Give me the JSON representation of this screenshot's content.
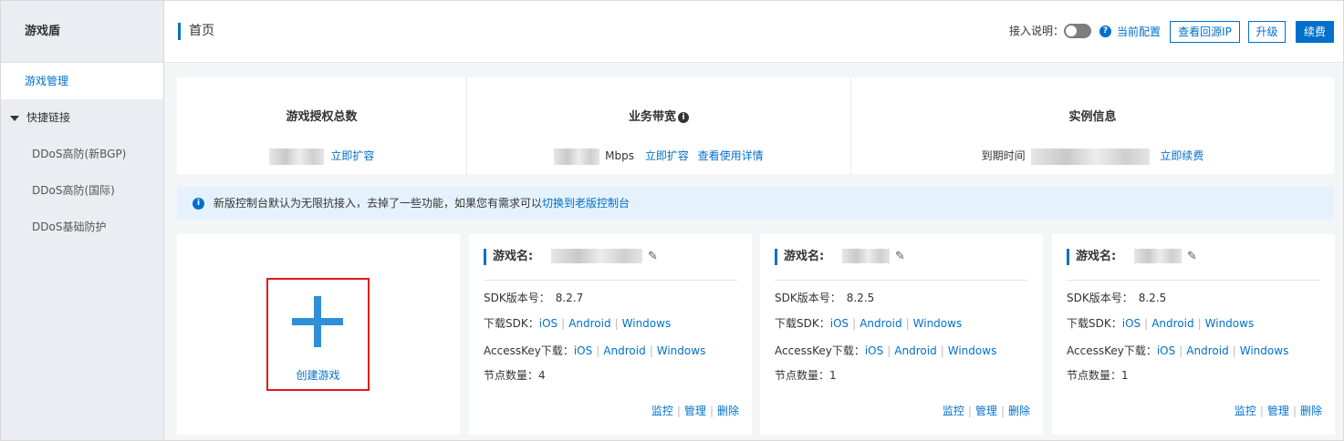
{
  "sidebar": {
    "title": "游戏盾",
    "active_item": "游戏管理",
    "group_label": "快捷链接",
    "links": [
      "DDoS高防(新BGP)",
      "DDoS高防(国际)",
      "DDoS基础防护"
    ]
  },
  "header": {
    "page_title": "首页",
    "access_label": "接入说明：",
    "current_config": "当前配置",
    "view_origin_ip": "查看回源IP",
    "upgrade": "升级",
    "renew": "续费"
  },
  "stats": {
    "license": {
      "title": "游戏授权总数",
      "action": "立即扩容"
    },
    "bandwidth": {
      "title": "业务带宽",
      "unit": "Mbps",
      "action": "立即扩容",
      "details": "查看使用详情"
    },
    "instance": {
      "title": "实例信息",
      "expire_label": "到期时间",
      "action": "立即续费"
    }
  },
  "notice": {
    "text": "新版控制台默认为无限抗接入，去掉了一些功能，如果您有需求可以",
    "link": "切换到老版控制台"
  },
  "create_card": {
    "label": "创建游戏"
  },
  "labels": {
    "game_name": "游戏名:",
    "sdk_version": "SDK版本号：",
    "download_sdk": "下载SDK：",
    "accesskey_download": "AccessKey下载：",
    "node_count": "节点数量：",
    "ios": "iOS",
    "android": "Android",
    "windows": "Windows",
    "monitor": "监控",
    "manage": "管理",
    "delete": "删除"
  },
  "games": [
    {
      "sdk_version": "8.2.7",
      "node_count": "4"
    },
    {
      "sdk_version": "8.2.5",
      "node_count": "1"
    },
    {
      "sdk_version": "8.2.5",
      "node_count": "1"
    }
  ],
  "colors": {
    "accent": "#0070cc",
    "highlight_border": "#e4171c",
    "sidebar_bg": "#eaedf1",
    "notice_bg": "#e5f2fd"
  }
}
